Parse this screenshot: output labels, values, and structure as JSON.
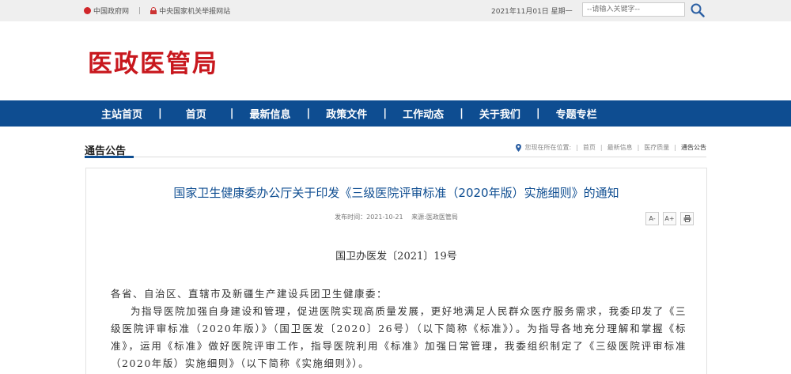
{
  "topbar": {
    "link_gov": "中国政府网",
    "separator": "|",
    "link_report": "中央国家机关举报网站",
    "date": "2021年11月01日 星期一",
    "search_placeholder": "--请输入关键字--"
  },
  "site": {
    "logo": "医政医管局"
  },
  "nav": {
    "items": [
      "主站首页",
      "首页",
      "最新信息",
      "政策文件",
      "工作动态",
      "关于我们",
      "专题专栏"
    ],
    "separator": "|"
  },
  "section": {
    "title": "通告公告",
    "breadcrumb_prefix": "您现在所在位置:",
    "breadcrumb": [
      "首页",
      "最新信息",
      "医疗质量",
      "通告公告"
    ],
    "breadcrumb_sep": "|"
  },
  "article": {
    "title": "国家卫生健康委办公厅关于印发《三级医院评审标准（2020年版）实施细则》的通知",
    "publish_date": "发布时间：2021-10-21",
    "source": "来源:医政医管局",
    "tools": {
      "font_smaller": "A-",
      "font_larger": "A+"
    },
    "doc_number": "国卫办医发〔2021〕19号",
    "salutation": "各省、自治区、直辖市及新疆生产建设兵团卫生健康委：",
    "paragraph": "为指导医院加强自身建设和管理，促进医院实现高质量发展，更好地满足人民群众医疗服务需求，我委印发了《三级医院评审标准（2020年版）》（国卫医发〔2020〕26号）（以下简称《标准》）。为指导各地充分理解和掌握《标准》，运用《标准》做好医院评审工作，指导医院利用《标准》加强日常管理，我委组织制定了《三级医院评审标准（2020年版）实施细则》（以下简称《实施细则》）。"
  },
  "colors": {
    "brand_red": "#c8181e",
    "nav_blue": "#0e4d91"
  }
}
